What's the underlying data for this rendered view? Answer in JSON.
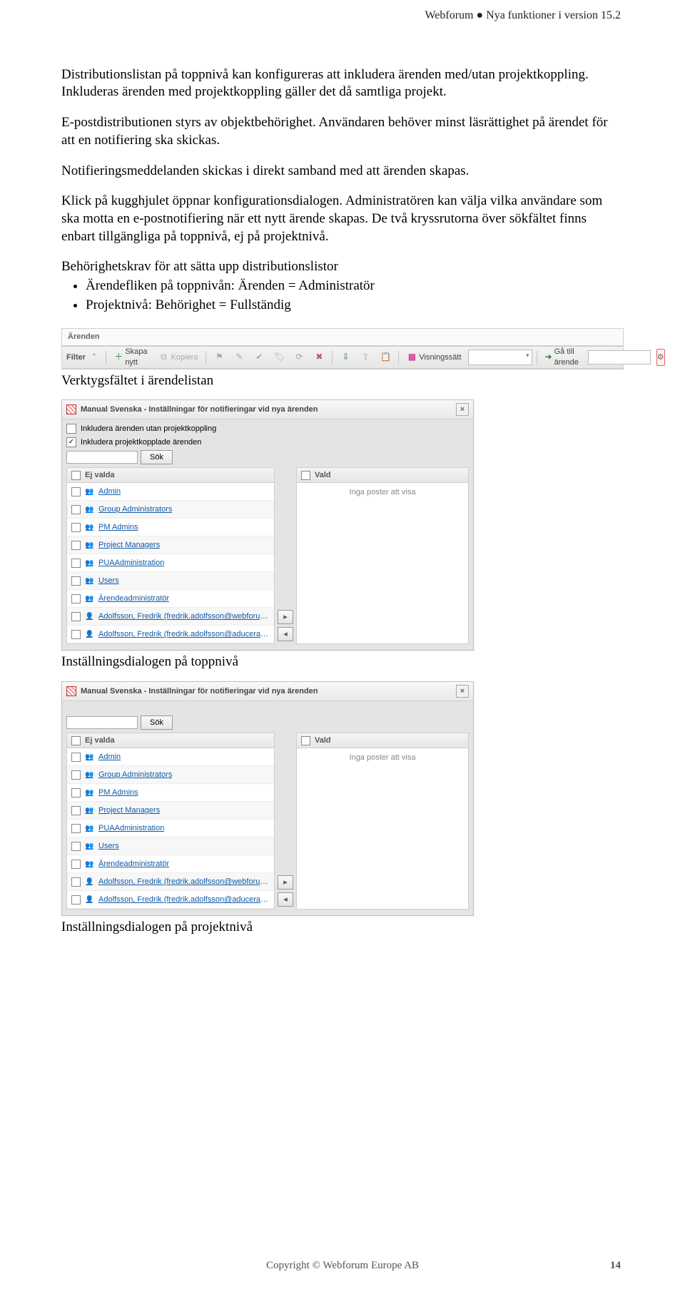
{
  "header": "Webforum ● Nya funktioner i version 15.2",
  "paras": {
    "p1": "Distributionslistan på toppnivå kan konfigureras att inkludera ärenden med/utan projektkoppling. Inkluderas ärenden med projektkoppling gäller det då samtliga projekt.",
    "p2": "E-postdistributionen styrs av objektbehörighet. Användaren behöver minst läsrättighet på ärendet för att en notifiering ska skickas.",
    "p3": "Notifieringsmeddelanden skickas i direkt samband med att ärenden skapas.",
    "p4": "Klick på kugghjulet öppnar konfigurationsdialogen. Administratören kan välja vilka användare som ska motta en e-postnotifiering när ett nytt ärende skapas. De två kryssrutorna över sökfältet finns enbart tillgängliga på toppnivå, ej på projektnivå.",
    "p5": "Behörighetskrav för att sätta upp distributionslistor",
    "bullets": [
      "Ärendefliken på toppnivån: Ärenden = Administratör",
      "Projektnivå: Behörighet = Fullständig"
    ]
  },
  "toolbar": {
    "tab_label": "Ärenden",
    "filter_label": "Filter",
    "create_label": "Skapa nytt",
    "copy_label": "Kopiera",
    "view_label": "Visningssätt",
    "goto_label": "Gå till ärende"
  },
  "caption1": "Verktygsfältet i ärendelistan",
  "caption2": "Inställningsdialogen på toppnivå",
  "caption3": "Inställningsdialogen på projektnivå",
  "dialog": {
    "title": "Manual Svenska - Inställningar för notifieringar vid nya ärenden",
    "chk1_label": "Inkludera ärenden utan projektkoppling",
    "chk2_label": "Inkludera projektkopplade ärenden",
    "search_btn": "Sök",
    "col_left": "Ej valda",
    "col_right": "Vald",
    "empty_right": "Inga poster att visa",
    "items": [
      {
        "type": "group",
        "label": "Admin"
      },
      {
        "type": "group",
        "label": "Group Administrators"
      },
      {
        "type": "group",
        "label": "PM Admins"
      },
      {
        "type": "group",
        "label": "Project Managers"
      },
      {
        "type": "group",
        "label": "PUAAdministration"
      },
      {
        "type": "group",
        "label": "Users"
      },
      {
        "type": "group",
        "label": "Ärendeadministratör"
      },
      {
        "type": "user",
        "label": "Adolfsson, Fredrik (fredrik.adolfsson@webforum.c..."
      },
      {
        "type": "user",
        "label": "Adolfsson, Fredrik (fredrik.adolfsson@aducera.co..."
      }
    ]
  },
  "footer": {
    "center": "Copyright © Webforum Europe AB",
    "page": "14"
  }
}
